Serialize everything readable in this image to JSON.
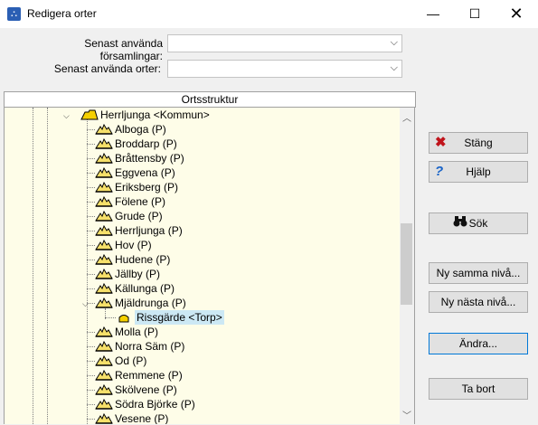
{
  "window": {
    "title": "Redigera orter",
    "minimize": "—",
    "maximize": "☐",
    "close": "✕"
  },
  "filters": {
    "parishes_label": "Senast använda församlingar:",
    "places_label": "Senast använda orter:",
    "parishes_value": "",
    "places_value": ""
  },
  "tree": {
    "header": "Ortsstruktur",
    "root": "Herrljunga <Kommun>",
    "items": [
      "Alboga (P)",
      "Broddarp (P)",
      "Bråttensby (P)",
      "Eggvena (P)",
      "Eriksberg (P)",
      "Fölene (P)",
      "Grude (P)",
      "Herrljunga (P)",
      "Hov (P)",
      "Hudene (P)",
      "Jällby (P)",
      "Källunga (P)",
      "Mjäldrunga (P)",
      "Rissgärde <Torp>",
      "Molla (P)",
      "Norra Säm (P)",
      "Od (P)",
      "Remmene (P)",
      "Skölvene (P)",
      "Södra Björke (P)",
      "Vesene (P)"
    ]
  },
  "buttons": {
    "close": "Stäng",
    "help": "Hjälp",
    "search": "Sök",
    "new_same_level": "Ny samma nivå...",
    "new_next_level": "Ny nästa nivå...",
    "edit": "Ändra...",
    "remove": "Ta bort"
  },
  "icons": {
    "close": "x-icon",
    "help": "question-icon",
    "search": "binoculars-icon"
  },
  "colors": {
    "tree_bg": "#fefde8",
    "selection": "#cce8f4",
    "accent": "#0078d7"
  }
}
